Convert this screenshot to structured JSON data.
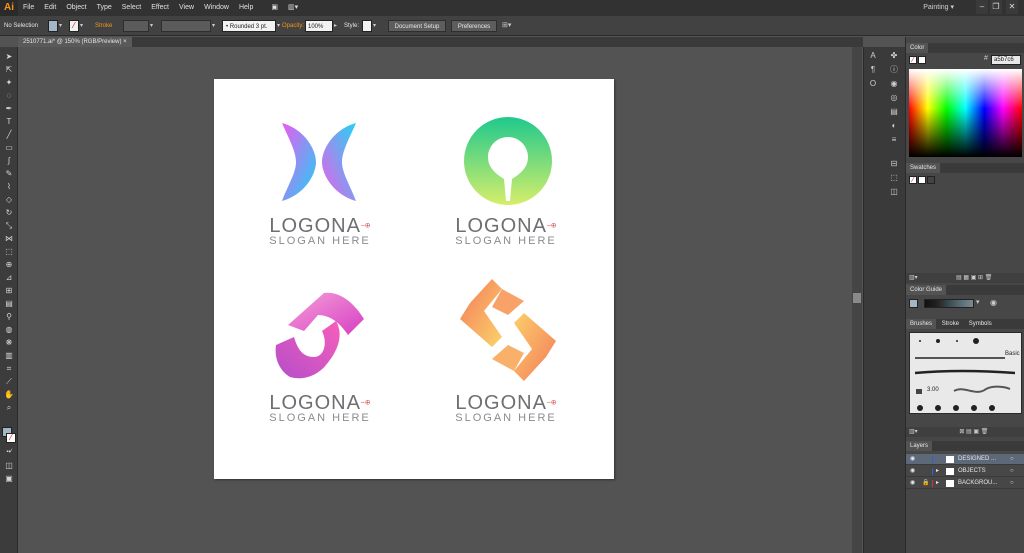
{
  "app": {
    "logo": "Ai",
    "workspace": "Painting"
  },
  "menu": [
    "File",
    "Edit",
    "Object",
    "Type",
    "Select",
    "Effect",
    "View",
    "Window",
    "Help"
  ],
  "window_controls": [
    "–",
    "❐",
    "✕"
  ],
  "control_bar": {
    "selection": "No Selection",
    "stroke_label": "Stroke",
    "brush_value": "Rounded 3 pt.",
    "opacity_label": "Opacity:",
    "opacity_value": "100%",
    "style_label": "Style:",
    "document_setup": "Document Setup",
    "preferences": "Preferences"
  },
  "document_tab": "2510771.ai* @ 150% (RGB/Preview)",
  "logos": [
    {
      "name": "LOGONA",
      "slogan": "SLOGAN HERE"
    },
    {
      "name": "LOGONA",
      "slogan": "SLOGAN HERE"
    },
    {
      "name": "LOGONA",
      "slogan": "SLOGAN HERE"
    },
    {
      "name": "LOGONA",
      "slogan": "SLOGAN HERE"
    }
  ],
  "panels": {
    "color": {
      "title": "Color",
      "hex": "a5b7c6"
    },
    "swatches": {
      "title": "Swatches"
    },
    "color_guide": {
      "title": "Color Guide"
    },
    "brushes": {
      "tabs": [
        "Brushes",
        "Stroke",
        "Symbols"
      ],
      "basic_label": "Basic",
      "size_label": "3.00"
    },
    "layers": {
      "title": "Layers",
      "rows": [
        {
          "name": "DESIGNED ..."
        },
        {
          "name": "OBJECTS"
        },
        {
          "name": "BACKGROU..."
        }
      ]
    }
  }
}
